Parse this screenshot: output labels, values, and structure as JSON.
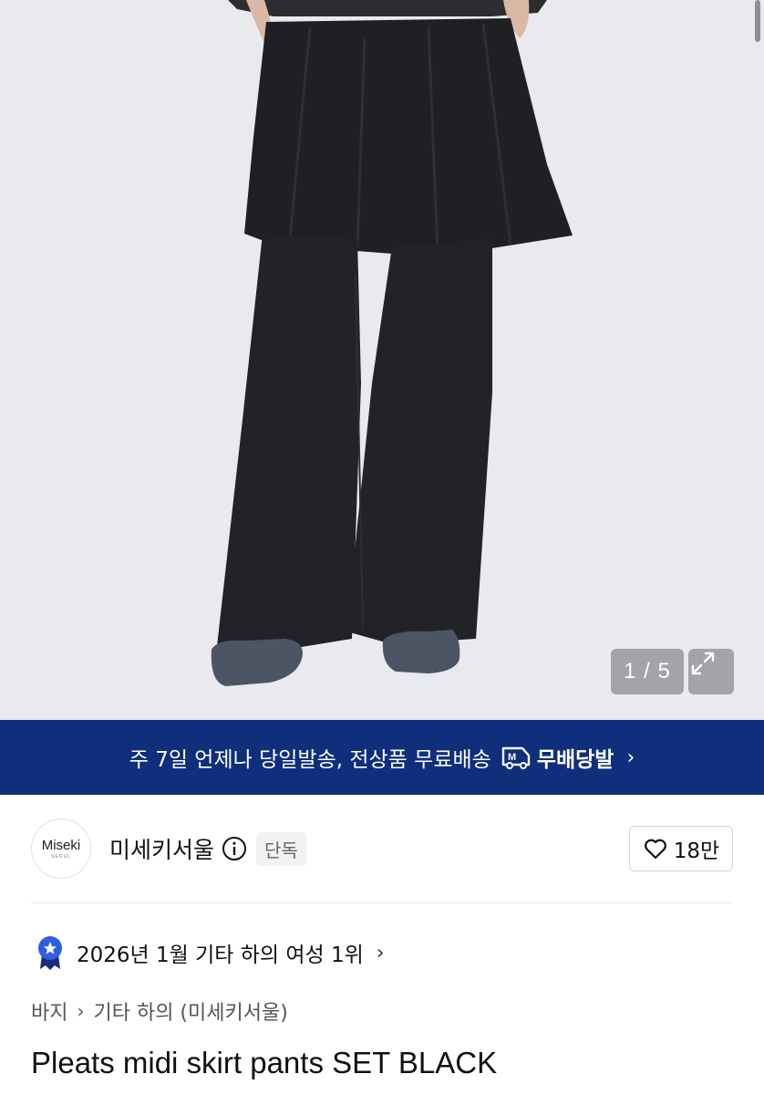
{
  "gallery": {
    "current": "1",
    "separator": " / ",
    "total": "5",
    "counter_text": "1 / 5",
    "expand_icon": "expand-icon"
  },
  "banner": {
    "text": "주 7일 언제나 당일발송, 전상품 무료배송",
    "badge_label": "무배당발",
    "badge_icon": "delivery-truck-m-icon",
    "chevron": "›",
    "background_color": "#0f2f7c"
  },
  "store": {
    "logo_text": "Miseki",
    "logo_sub": "SEOUL",
    "name": "미세키서울",
    "info_icon": "info-icon",
    "exclusive_badge": "단독",
    "like_count": "18만",
    "like_icon": "heart-icon"
  },
  "ranking": {
    "text": "2026년 1월 기타 하의 여성 1위",
    "icon": "medal-icon",
    "chevron": "›"
  },
  "breadcrumb": {
    "items": [
      "바지",
      "기타 하의 (미세키서울)"
    ],
    "separator": "›"
  },
  "product": {
    "title": "Pleats midi skirt pants SET BLACK"
  }
}
